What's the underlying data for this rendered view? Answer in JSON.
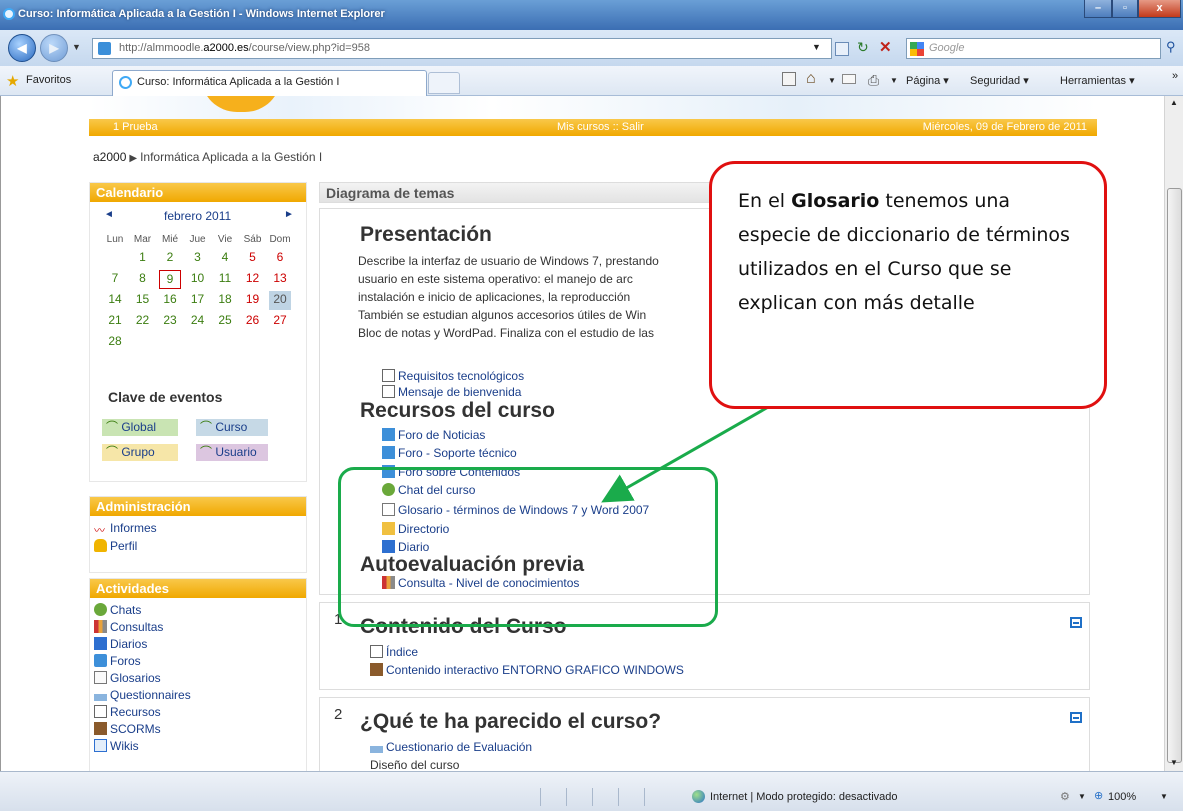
{
  "window": {
    "title": "Curso: Informática Aplicada a la Gestión I - Windows Internet Explorer"
  },
  "address": {
    "url_prefix": "http://almmoodle.",
    "url_domain": "a2000.es",
    "url_suffix": "/course/view.php?id=958",
    "search_placeholder": "Google"
  },
  "favorites": {
    "favorites_label": "Favoritos",
    "tab_title": "Curso: Informática Aplicada a la Gestión I",
    "menu_page": "Página ▾",
    "menu_security": "Seguridad ▾",
    "menu_tools": "Herramientas ▾"
  },
  "page": {
    "band_left": "1 Prueba",
    "band_center": "Mis cursos :: Salir",
    "band_right": "Miércoles, 09 de Febrero de 2011",
    "breadcrumb_home": "a2000",
    "breadcrumb_sep": "▶",
    "breadcrumb_course": "Informática Aplicada a la Gestión I"
  },
  "calendar": {
    "title": "Calendario",
    "month": "febrero 2011",
    "prev": "◄",
    "next": "►",
    "dow": [
      "Lun",
      "Mar",
      "Mié",
      "Jue",
      "Vie",
      "Sáb",
      "Dom"
    ],
    "weeks": [
      [
        "",
        "1",
        "2",
        "3",
        "4",
        "5",
        "6"
      ],
      [
        "7",
        "8",
        "9",
        "10",
        "11",
        "12",
        "13"
      ],
      [
        "14",
        "15",
        "16",
        "17",
        "18",
        "19",
        "20"
      ],
      [
        "21",
        "22",
        "23",
        "24",
        "25",
        "26",
        "27"
      ],
      [
        "28",
        "",
        "",
        "",
        "",
        "",
        ""
      ]
    ],
    "events_title": "Clave de eventos",
    "events": [
      "Global",
      "Curso",
      "Grupo",
      "Usuario"
    ]
  },
  "administration": {
    "title": "Administración",
    "items": [
      "Informes",
      "Perfil"
    ]
  },
  "activities": {
    "title": "Actividades",
    "items": [
      "Chats",
      "Consultas",
      "Diarios",
      "Foros",
      "Glosarios",
      "Questionnaires",
      "Recursos",
      "SCORMs",
      "Wikis"
    ]
  },
  "main": {
    "header": "Diagrama de temas",
    "section0": {
      "title": "Presentación",
      "desc_lines": [
        "Describe la interfaz de usuario de Windows 7, prestando",
        "usuario en este sistema operativo: el manejo de arc",
        "instalación e inicio de aplicaciones, la reproducción",
        "También se estudian algunos accesorios útiles de Win",
        "Bloc de notas y WordPad. Finaliza con el estudio de las"
      ],
      "resources": [
        "Requisitos tecnológicos",
        "Mensaje de bienvenida"
      ],
      "recursos_title": "Recursos del curso",
      "recursos": [
        "Foro de Noticias",
        "Foro - Soporte técnico",
        "Foro sobre Contenidos",
        "Chat del curso",
        "Glosario - términos de Windows 7 y Word 2007",
        "Directorio",
        "Diario"
      ],
      "auto_title": "Autoevaluación previa",
      "auto": [
        "Consulta - Nivel de conocimientos"
      ]
    },
    "section1": {
      "num": "1",
      "title": "Contenido del Curso",
      "items": [
        "Índice",
        "Contenido interactivo ENTORNO GRAFICO WINDOWS"
      ]
    },
    "section2": {
      "num": "2",
      "title": "¿Qué te ha parecido el curso?",
      "items": [
        "Cuestionario de Evaluación"
      ],
      "text": "Diseño del curso"
    }
  },
  "callout": {
    "before": "En el ",
    "bold": "Glosario",
    "after": " tenemos una especie de diccionario de términos utilizados en el Curso  que se explican con más detalle"
  },
  "statusbar": {
    "zone": "Internet | Modo protegido: desactivado",
    "zoom": "100%"
  },
  "colors": {
    "band": "#f0a800",
    "link": "#1a3e8a",
    "callout_border": "#e01010",
    "highlight_box": "#1aab4b"
  }
}
